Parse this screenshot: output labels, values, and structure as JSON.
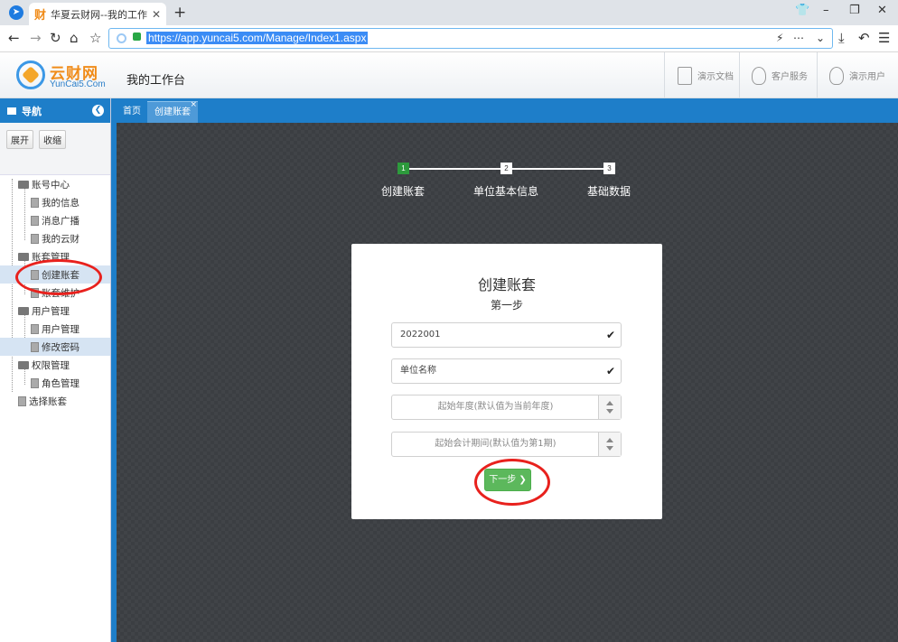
{
  "browser": {
    "tab_title": "华夏云财网--我的工作台",
    "tab_favicon": "财",
    "new_tab": "+",
    "url": "https://app.yuncai5.com/Manage/Index1.aspx",
    "window_controls": [
      "⌕",
      "–",
      "❐",
      "✕"
    ]
  },
  "header": {
    "logo_name": "云财网",
    "logo_sub": "YunCai5.Com",
    "title": "我的工作台",
    "links": [
      "演示文档",
      "客户服务",
      "演示用户"
    ]
  },
  "sidebar": {
    "title": "导航",
    "expand_label": "展开",
    "collapse_label": "收缩",
    "tree": [
      {
        "label": "账号中心",
        "type": "folder",
        "level": 0
      },
      {
        "label": "我的信息",
        "type": "file",
        "level": 1
      },
      {
        "label": "消息广播",
        "type": "file",
        "level": 1
      },
      {
        "label": "我的云财",
        "type": "file",
        "level": 1
      },
      {
        "label": "账套管理",
        "type": "folder",
        "level": 0
      },
      {
        "label": "创建账套",
        "type": "file",
        "level": 1,
        "selected": true
      },
      {
        "label": "账套维护",
        "type": "file",
        "level": 1
      },
      {
        "label": "用户管理",
        "type": "folder",
        "level": 0
      },
      {
        "label": "用户管理",
        "type": "file",
        "level": 1
      },
      {
        "label": "修改密码",
        "type": "file",
        "level": 1,
        "highlight": true
      },
      {
        "label": "权限管理",
        "type": "folder",
        "level": 0
      },
      {
        "label": "角色管理",
        "type": "file",
        "level": 1
      },
      {
        "label": "选择账套",
        "type": "file",
        "level": 0
      }
    ]
  },
  "content_tabs": {
    "home": "首页",
    "current": "创建账套",
    "close": "×"
  },
  "wizard": {
    "steps": [
      {
        "num": "1",
        "label": "创建账套",
        "active": true
      },
      {
        "num": "2",
        "label": "单位基本信息",
        "active": false
      },
      {
        "num": "3",
        "label": "基础数据",
        "active": false
      }
    ],
    "card_title": "创建账套",
    "card_subtitle": "第一步",
    "account_code": "2022001",
    "company_name": "单位名称",
    "start_year_placeholder": "起始年度(默认值为当前年度)",
    "start_period_placeholder": "起始会计期间(默认值为第1期)",
    "next_button": "下一步 ❯",
    "check_icon": "✔"
  },
  "colors": {
    "brand_blue": "#1e7ec9",
    "step_active": "#2d9a3c",
    "next_green": "#5cb85c",
    "annotation_red": "#e8211d",
    "logo_orange": "#f08c1a"
  }
}
